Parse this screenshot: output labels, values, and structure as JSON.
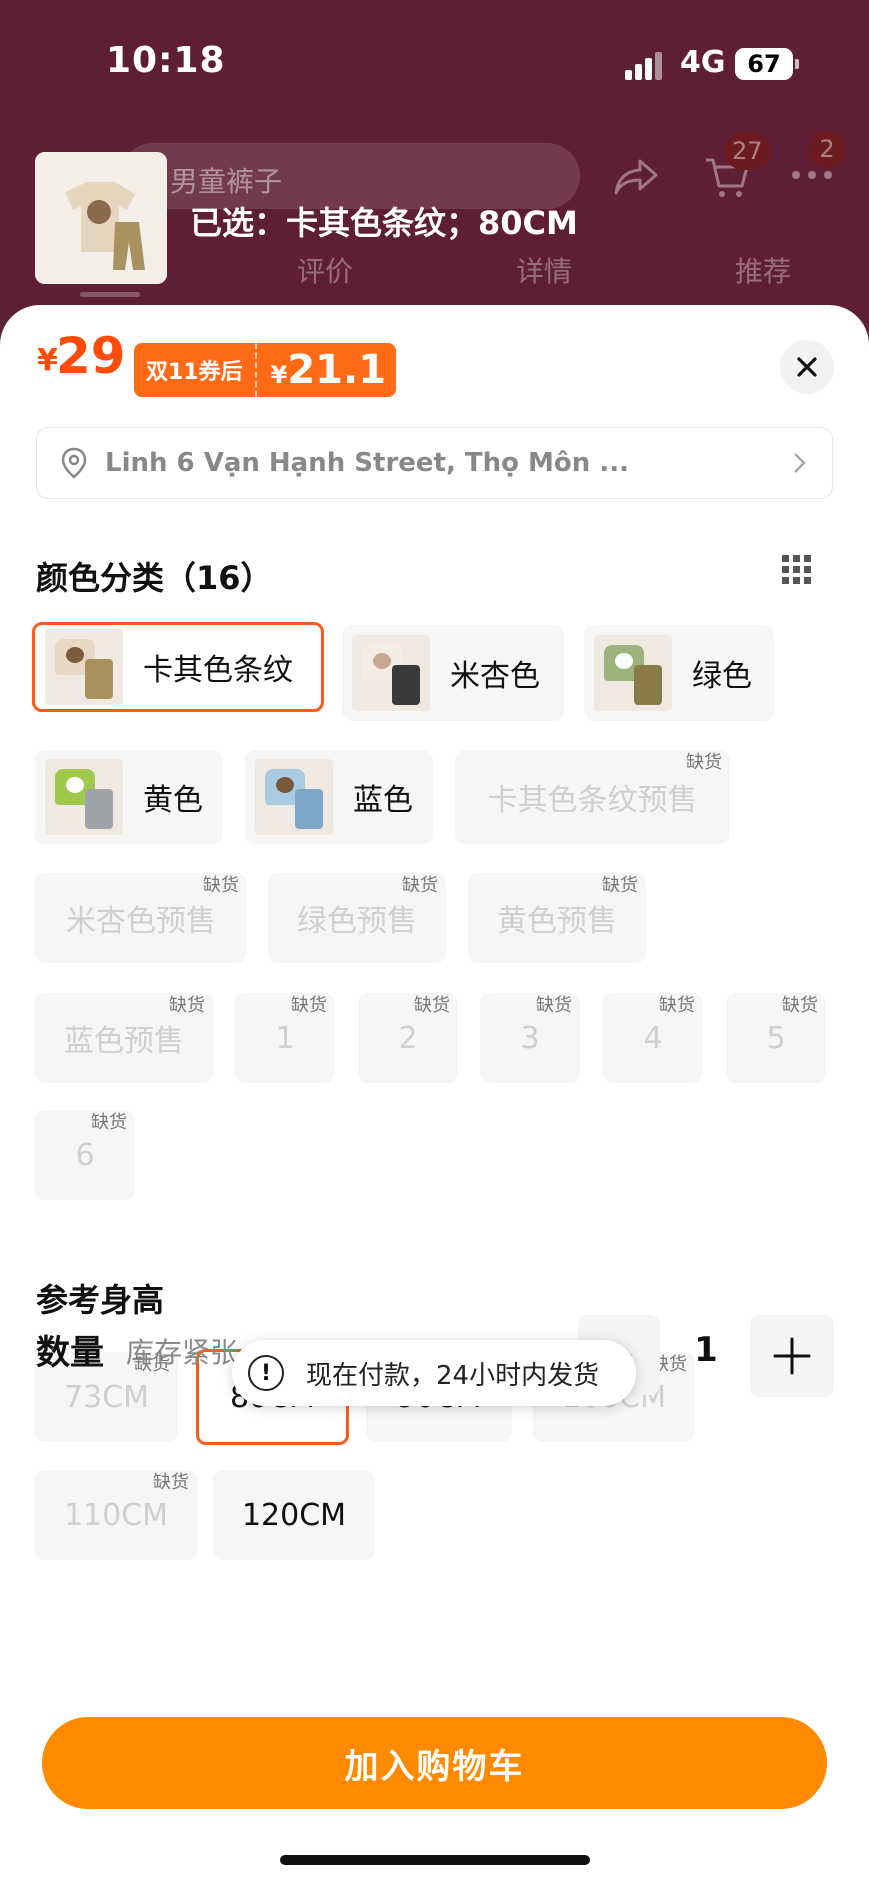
{
  "status_bar": {
    "time": "10:18",
    "network": "4G",
    "battery": "67"
  },
  "header": {
    "search_text": "男童裤子",
    "cart_count": "27",
    "more_count": "2",
    "tabs": [
      "评价",
      "详情",
      "推荐"
    ]
  },
  "selection_summary": "已选：卡其色条纹；80CM",
  "price": {
    "currency": "¥",
    "value": "29",
    "coupon_label": "双11券后",
    "coupon_currency": "¥",
    "coupon_value": "21.1"
  },
  "address": {
    "text": "Linh 6 Vạn Hạnh Street, Thọ Môn ..."
  },
  "color_section": {
    "title": "颜色分类（16）",
    "options": [
      {
        "label": "卡其色条纹"
      },
      {
        "label": "米杏色"
      },
      {
        "label": "绿色"
      },
      {
        "label": "黄色"
      },
      {
        "label": "蓝色"
      },
      {
        "label": "卡其色条纹预售",
        "stock": "缺货"
      },
      {
        "label": "米杏色预售",
        "stock": "缺货"
      },
      {
        "label": "绿色预售",
        "stock": "缺货"
      },
      {
        "label": "黄色预售",
        "stock": "缺货"
      },
      {
        "label": "蓝色预售",
        "stock": "缺货"
      },
      {
        "label": "1",
        "stock": "缺货"
      },
      {
        "label": "2",
        "stock": "缺货"
      },
      {
        "label": "3",
        "stock": "缺货"
      },
      {
        "label": "4",
        "stock": "缺货"
      },
      {
        "label": "5",
        "stock": "缺货"
      },
      {
        "label": "6",
        "stock": "缺货"
      }
    ]
  },
  "height_section": {
    "title": "参考身高",
    "options": [
      {
        "label": "73CM",
        "stock": "缺货"
      },
      {
        "label": "80CM"
      },
      {
        "label": "90CM"
      },
      {
        "label": "100CM",
        "stock": "缺货"
      },
      {
        "label": "110CM",
        "stock": "缺货"
      },
      {
        "label": "120CM"
      }
    ]
  },
  "quantity": {
    "label": "数量",
    "note": "库存紧张",
    "value": "1",
    "minus": "−"
  },
  "toast": {
    "icon": "!",
    "text": "现在付款，24小时内发货"
  },
  "add_to_cart": "加入购物车",
  "colors": {
    "accent": "#ff5a19",
    "button": "#ff8a00",
    "price": "#ff4c0a"
  }
}
